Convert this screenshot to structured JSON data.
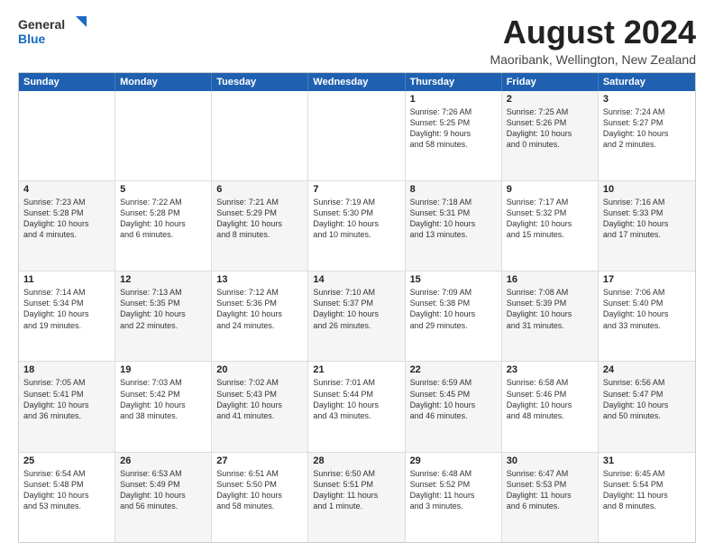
{
  "logo": {
    "general": "General",
    "blue": "Blue"
  },
  "title": "August 2024",
  "location": "Maoribank, Wellington, New Zealand",
  "header_days": [
    "Sunday",
    "Monday",
    "Tuesday",
    "Wednesday",
    "Thursday",
    "Friday",
    "Saturday"
  ],
  "rows": [
    [
      {
        "day": "",
        "text": "",
        "bg": "empty"
      },
      {
        "day": "",
        "text": "",
        "bg": "empty"
      },
      {
        "day": "",
        "text": "",
        "bg": "empty"
      },
      {
        "day": "",
        "text": "",
        "bg": "empty"
      },
      {
        "day": "1",
        "text": "Sunrise: 7:26 AM\nSunset: 5:25 PM\nDaylight: 9 hours\nand 58 minutes.",
        "bg": "white"
      },
      {
        "day": "2",
        "text": "Sunrise: 7:25 AM\nSunset: 5:26 PM\nDaylight: 10 hours\nand 0 minutes.",
        "bg": "alt"
      },
      {
        "day": "3",
        "text": "Sunrise: 7:24 AM\nSunset: 5:27 PM\nDaylight: 10 hours\nand 2 minutes.",
        "bg": "white"
      }
    ],
    [
      {
        "day": "4",
        "text": "Sunrise: 7:23 AM\nSunset: 5:28 PM\nDaylight: 10 hours\nand 4 minutes.",
        "bg": "alt"
      },
      {
        "day": "5",
        "text": "Sunrise: 7:22 AM\nSunset: 5:28 PM\nDaylight: 10 hours\nand 6 minutes.",
        "bg": "white"
      },
      {
        "day": "6",
        "text": "Sunrise: 7:21 AM\nSunset: 5:29 PM\nDaylight: 10 hours\nand 8 minutes.",
        "bg": "alt"
      },
      {
        "day": "7",
        "text": "Sunrise: 7:19 AM\nSunset: 5:30 PM\nDaylight: 10 hours\nand 10 minutes.",
        "bg": "white"
      },
      {
        "day": "8",
        "text": "Sunrise: 7:18 AM\nSunset: 5:31 PM\nDaylight: 10 hours\nand 13 minutes.",
        "bg": "alt"
      },
      {
        "day": "9",
        "text": "Sunrise: 7:17 AM\nSunset: 5:32 PM\nDaylight: 10 hours\nand 15 minutes.",
        "bg": "white"
      },
      {
        "day": "10",
        "text": "Sunrise: 7:16 AM\nSunset: 5:33 PM\nDaylight: 10 hours\nand 17 minutes.",
        "bg": "alt"
      }
    ],
    [
      {
        "day": "11",
        "text": "Sunrise: 7:14 AM\nSunset: 5:34 PM\nDaylight: 10 hours\nand 19 minutes.",
        "bg": "white"
      },
      {
        "day": "12",
        "text": "Sunrise: 7:13 AM\nSunset: 5:35 PM\nDaylight: 10 hours\nand 22 minutes.",
        "bg": "alt"
      },
      {
        "day": "13",
        "text": "Sunrise: 7:12 AM\nSunset: 5:36 PM\nDaylight: 10 hours\nand 24 minutes.",
        "bg": "white"
      },
      {
        "day": "14",
        "text": "Sunrise: 7:10 AM\nSunset: 5:37 PM\nDaylight: 10 hours\nand 26 minutes.",
        "bg": "alt"
      },
      {
        "day": "15",
        "text": "Sunrise: 7:09 AM\nSunset: 5:38 PM\nDaylight: 10 hours\nand 29 minutes.",
        "bg": "white"
      },
      {
        "day": "16",
        "text": "Sunrise: 7:08 AM\nSunset: 5:39 PM\nDaylight: 10 hours\nand 31 minutes.",
        "bg": "alt"
      },
      {
        "day": "17",
        "text": "Sunrise: 7:06 AM\nSunset: 5:40 PM\nDaylight: 10 hours\nand 33 minutes.",
        "bg": "white"
      }
    ],
    [
      {
        "day": "18",
        "text": "Sunrise: 7:05 AM\nSunset: 5:41 PM\nDaylight: 10 hours\nand 36 minutes.",
        "bg": "alt"
      },
      {
        "day": "19",
        "text": "Sunrise: 7:03 AM\nSunset: 5:42 PM\nDaylight: 10 hours\nand 38 minutes.",
        "bg": "white"
      },
      {
        "day": "20",
        "text": "Sunrise: 7:02 AM\nSunset: 5:43 PM\nDaylight: 10 hours\nand 41 minutes.",
        "bg": "alt"
      },
      {
        "day": "21",
        "text": "Sunrise: 7:01 AM\nSunset: 5:44 PM\nDaylight: 10 hours\nand 43 minutes.",
        "bg": "white"
      },
      {
        "day": "22",
        "text": "Sunrise: 6:59 AM\nSunset: 5:45 PM\nDaylight: 10 hours\nand 46 minutes.",
        "bg": "alt"
      },
      {
        "day": "23",
        "text": "Sunrise: 6:58 AM\nSunset: 5:46 PM\nDaylight: 10 hours\nand 48 minutes.",
        "bg": "white"
      },
      {
        "day": "24",
        "text": "Sunrise: 6:56 AM\nSunset: 5:47 PM\nDaylight: 10 hours\nand 50 minutes.",
        "bg": "alt"
      }
    ],
    [
      {
        "day": "25",
        "text": "Sunrise: 6:54 AM\nSunset: 5:48 PM\nDaylight: 10 hours\nand 53 minutes.",
        "bg": "white"
      },
      {
        "day": "26",
        "text": "Sunrise: 6:53 AM\nSunset: 5:49 PM\nDaylight: 10 hours\nand 56 minutes.",
        "bg": "alt"
      },
      {
        "day": "27",
        "text": "Sunrise: 6:51 AM\nSunset: 5:50 PM\nDaylight: 10 hours\nand 58 minutes.",
        "bg": "white"
      },
      {
        "day": "28",
        "text": "Sunrise: 6:50 AM\nSunset: 5:51 PM\nDaylight: 11 hours\nand 1 minute.",
        "bg": "alt"
      },
      {
        "day": "29",
        "text": "Sunrise: 6:48 AM\nSunset: 5:52 PM\nDaylight: 11 hours\nand 3 minutes.",
        "bg": "white"
      },
      {
        "day": "30",
        "text": "Sunrise: 6:47 AM\nSunset: 5:53 PM\nDaylight: 11 hours\nand 6 minutes.",
        "bg": "alt"
      },
      {
        "day": "31",
        "text": "Sunrise: 6:45 AM\nSunset: 5:54 PM\nDaylight: 11 hours\nand 8 minutes.",
        "bg": "white"
      }
    ]
  ]
}
